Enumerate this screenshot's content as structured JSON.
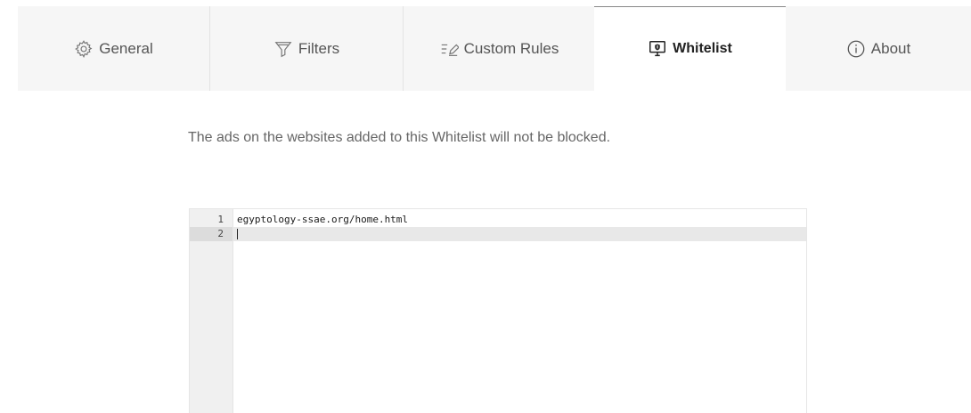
{
  "tabs": {
    "general": {
      "label": "General",
      "icon": "gear-icon"
    },
    "filters": {
      "label": "Filters",
      "icon": "funnel-icon"
    },
    "custom_rules": {
      "label": "Custom Rules",
      "icon": "edit-list-icon"
    },
    "whitelist": {
      "label": "Whitelist",
      "icon": "monitor-shield-icon",
      "active": true
    },
    "about": {
      "label": "About",
      "icon": "info-icon"
    }
  },
  "whitelist_page": {
    "description": "The ads on the websites added to this Whitelist will not be blocked.",
    "editor": {
      "lines": [
        {
          "number": "1",
          "text": "egyptology-ssae.org/home.html"
        },
        {
          "number": "2",
          "text": ""
        }
      ]
    }
  },
  "colors": {
    "tabbar_bg": "#f6f6f6",
    "active_tab_bg": "#ffffff",
    "text": "#555555",
    "active_line": "#e8e8e8"
  }
}
